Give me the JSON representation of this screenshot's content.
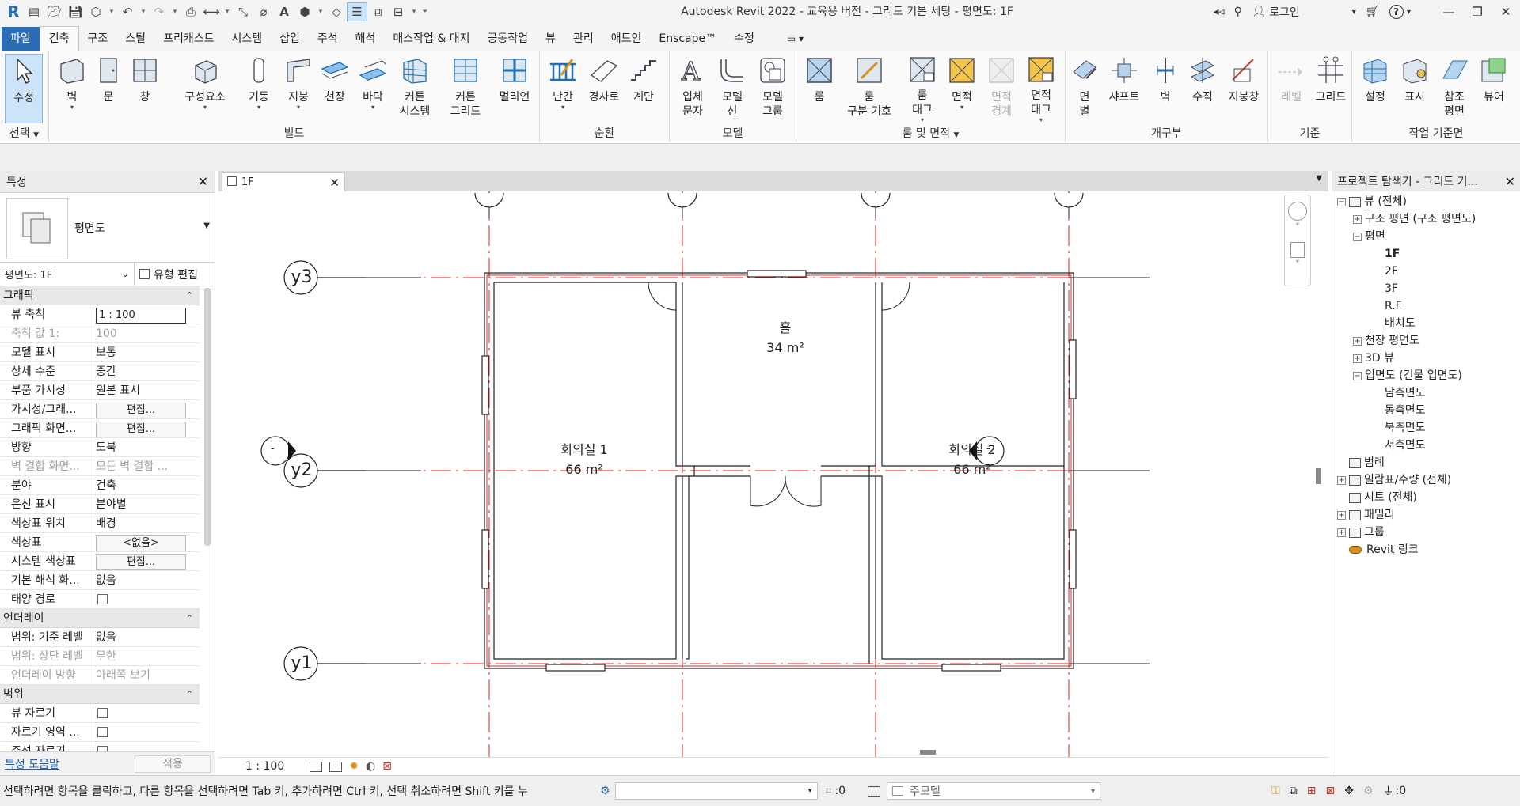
{
  "app": {
    "title": "Autodesk Revit 2022 - 교육용 버전 - 그리드 기본 세팅 - 평면도: 1F",
    "login": "로그인",
    "logo": "R"
  },
  "tabs": [
    "파일",
    "건축",
    "구조",
    "스틸",
    "프리캐스트",
    "시스템",
    "삽입",
    "주석",
    "해석",
    "매스작업 & 대지",
    "공동작업",
    "뷰",
    "관리",
    "애드인",
    "Enscape™",
    "수정"
  ],
  "ribbon": {
    "select": {
      "label": "수정",
      "panel": "선택"
    },
    "build": {
      "panel": "빌드",
      "buttons": [
        "벽",
        "문",
        "창",
        "구성요소",
        "기둥",
        "지붕",
        "천장",
        "바닥",
        "커튼\n시스템",
        "커튼\n그리드",
        "멀리언"
      ]
    },
    "circulation": {
      "panel": "순환",
      "buttons": [
        "난간",
        "경사로",
        "계단"
      ]
    },
    "model": {
      "panel": "모델",
      "buttons": [
        "입체\n문자",
        "모델\n선",
        "모델\n그룹"
      ]
    },
    "room_area": {
      "panel": "룸 및 면적",
      "buttons": [
        "룸",
        "룸\n구분 기호",
        "룸\n태그",
        "면적",
        "면적\n경계",
        "면적\n태그"
      ]
    },
    "opening": {
      "panel": "개구부",
      "buttons": [
        "면\n별",
        "샤프트",
        "벽",
        "수직",
        "지붕창"
      ]
    },
    "datum": {
      "panel": "기준",
      "buttons": [
        "레벨",
        "그리드"
      ]
    },
    "workplane": {
      "panel": "작업 기준면",
      "buttons": [
        "설정",
        "표시",
        "참조\n평면",
        "뷰어"
      ]
    }
  },
  "properties": {
    "header": "특성",
    "type_name": "평면도",
    "instance": "평면도: 1F",
    "edit_type": "유형 편집",
    "groups": [
      {
        "name": "그래픽",
        "rows": [
          {
            "k": "뷰 축척",
            "v": "1 : 100",
            "kind": "input"
          },
          {
            "k": "축척 값    1:",
            "v": "100",
            "kind": "dim"
          },
          {
            "k": "모델 표시",
            "v": "보통"
          },
          {
            "k": "상세 수준",
            "v": "중간"
          },
          {
            "k": "부품 가시성",
            "v": "원본 표시"
          },
          {
            "k": "가시성/그래...",
            "v": "편집...",
            "kind": "button"
          },
          {
            "k": "그래픽 화면...",
            "v": "편집...",
            "kind": "button"
          },
          {
            "k": "방향",
            "v": "도북"
          },
          {
            "k": "벽 결합 화면...",
            "v": "모든 벽 결합 ...",
            "kind": "dim"
          },
          {
            "k": "분야",
            "v": "건축"
          },
          {
            "k": "은선 표시",
            "v": "분야별"
          },
          {
            "k": "색상표 위치",
            "v": "배경"
          },
          {
            "k": "색상표",
            "v": "<없음>",
            "kind": "button"
          },
          {
            "k": "시스템 색상표",
            "v": "편집...",
            "kind": "button"
          },
          {
            "k": "기본 해석 화...",
            "v": "없음"
          },
          {
            "k": "태양 경로",
            "v": "",
            "kind": "check"
          }
        ]
      },
      {
        "name": "언더레이",
        "rows": [
          {
            "k": "범위: 기준 레벨",
            "v": "없음"
          },
          {
            "k": "범위: 상단 레벨",
            "v": "무한",
            "kind": "dim"
          },
          {
            "k": "언더레이 방향",
            "v": "아래쪽 보기",
            "kind": "dim"
          }
        ]
      },
      {
        "name": "범위",
        "rows": [
          {
            "k": "뷰 자르기",
            "v": "",
            "kind": "check"
          },
          {
            "k": "자르기 영역 ...",
            "v": "",
            "kind": "check"
          },
          {
            "k": "주석 자르기",
            "v": "",
            "kind": "check"
          }
        ]
      }
    ],
    "help": "특성 도움말",
    "apply": "적용"
  },
  "view": {
    "tab": "1F",
    "scale": "1 : 100",
    "grids": [
      "y3",
      "y2",
      "y1"
    ],
    "rooms": [
      {
        "name": "홀",
        "area": "34 m²"
      },
      {
        "name": "회의실 1",
        "area": "66 m²"
      },
      {
        "name": "회의실 2",
        "area": "66 m²"
      }
    ],
    "elev_marks": [
      "-",
      "-"
    ]
  },
  "browser": {
    "header": "프로젝트 탐색기 - 그리드 기...",
    "nodes": [
      {
        "label": "뷰 (전체)",
        "level": 0,
        "pm": "-",
        "icon": true
      },
      {
        "label": "구조 평면 (구조 평면도)",
        "level": 1,
        "pm": "+"
      },
      {
        "label": "평면",
        "level": 1,
        "pm": "-"
      },
      {
        "label": "1F",
        "level": 2,
        "bold": true
      },
      {
        "label": "2F",
        "level": 2
      },
      {
        "label": "3F",
        "level": 2
      },
      {
        "label": "R.F",
        "level": 2
      },
      {
        "label": "배치도",
        "level": 2
      },
      {
        "label": "천장 평면도",
        "level": 1,
        "pm": "+"
      },
      {
        "label": "3D 뷰",
        "level": 1,
        "pm": "+"
      },
      {
        "label": "입면도 (건물 입면도)",
        "level": 1,
        "pm": "-"
      },
      {
        "label": "남측면도",
        "level": 2
      },
      {
        "label": "동측면도",
        "level": 2
      },
      {
        "label": "북측면도",
        "level": 2
      },
      {
        "label": "서측면도",
        "level": 2
      },
      {
        "label": "범례",
        "level": 0,
        "icon": true
      },
      {
        "label": "일람표/수량 (전체)",
        "level": 0,
        "pm": "+",
        "icon": true
      },
      {
        "label": "시트 (전체)",
        "level": 0,
        "icon": true
      },
      {
        "label": "패밀리",
        "level": 0,
        "pm": "+",
        "icon": true
      },
      {
        "label": "그룹",
        "level": 0,
        "pm": "+",
        "icon": true
      },
      {
        "label": "Revit 링크",
        "level": 0,
        "icon": true,
        "link": true
      }
    ]
  },
  "status": {
    "message": "선택하려면 항목을 클릭하고, 다른 항목을 선택하려면 Tab 키, 추가하려면 Ctrl 키, 선택 취소하려면 Shift 키를 누",
    "count1": ":0",
    "model": "주모델",
    "count2": ":0"
  },
  "colors": {
    "accent": "#2a6cb6",
    "grid_line": "#e02020",
    "wall": "#222222",
    "ribbon_bg": "#fafafa"
  }
}
